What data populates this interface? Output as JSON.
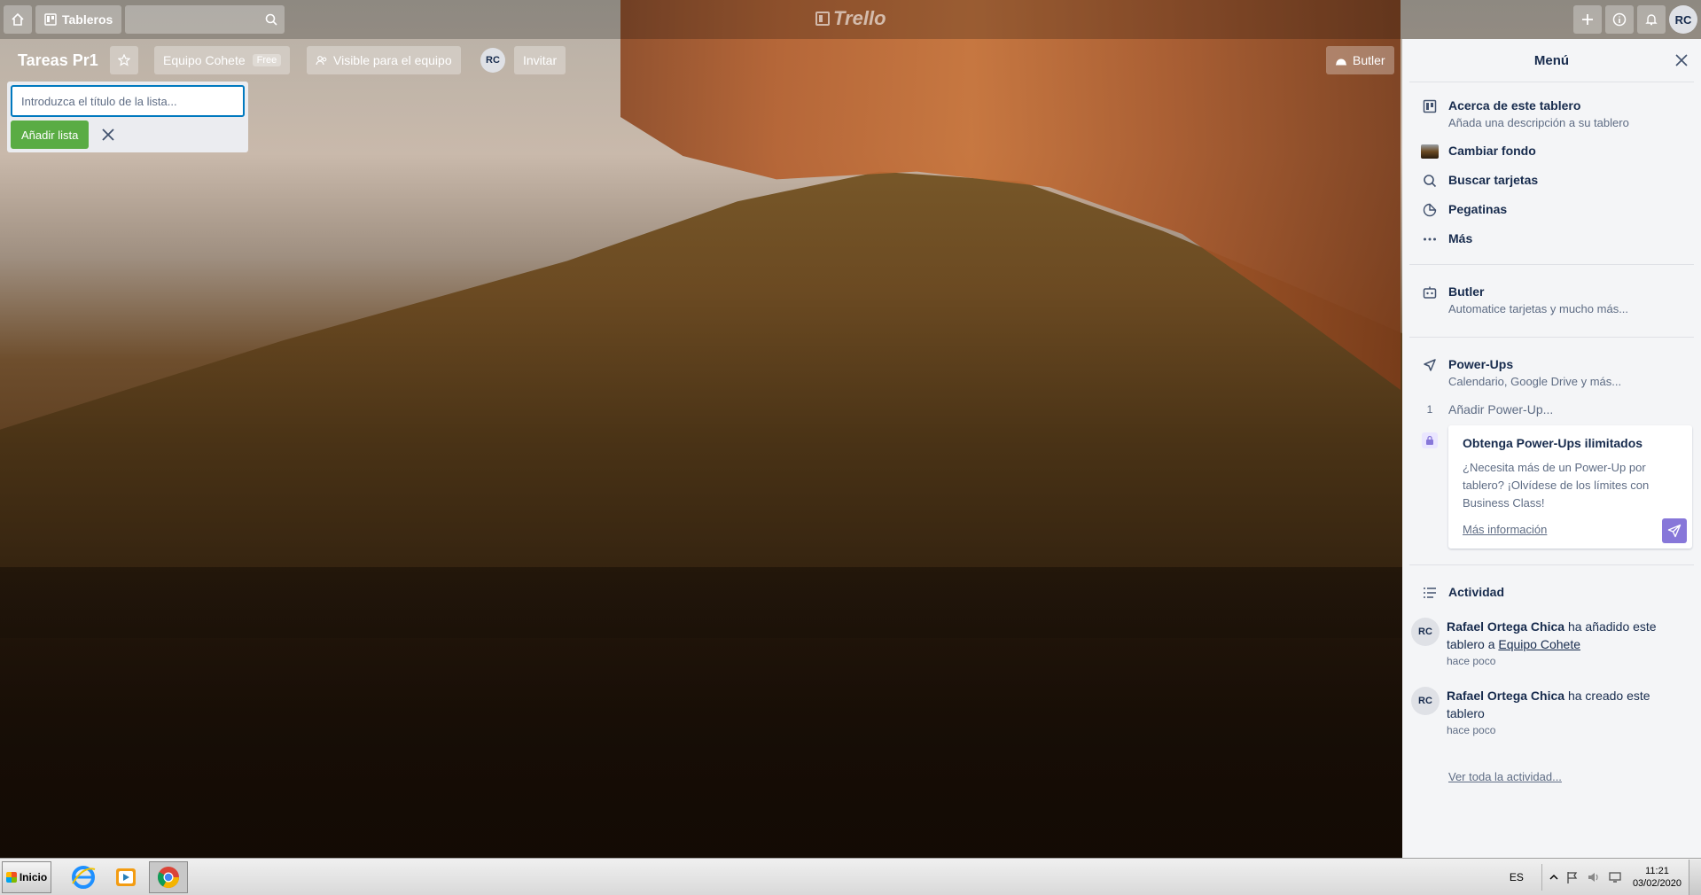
{
  "header": {
    "boards_label": "Tableros",
    "logo_text": "Trello",
    "user_initials": "RC"
  },
  "board": {
    "title": "Tareas Pr1",
    "team_label": "Equipo Cohete",
    "team_badge": "Free",
    "visibility_label": "Visible para el equipo",
    "member_initials": "RC",
    "invite_label": "Invitar",
    "butler_label": "Butler"
  },
  "composer": {
    "placeholder": "Introduzca el título de la lista...",
    "add_label": "Añadir lista"
  },
  "menu": {
    "title": "Menú",
    "items": [
      {
        "title": "Acerca de este tablero",
        "subtitle": "Añada una descripción a su tablero"
      },
      {
        "title": "Cambiar fondo"
      },
      {
        "title": "Buscar tarjetas"
      },
      {
        "title": "Pegatinas"
      },
      {
        "title": "Más"
      }
    ],
    "butler": {
      "title": "Butler",
      "subtitle": "Automatice tarjetas y mucho más..."
    },
    "powerups": {
      "title": "Power-Ups",
      "subtitle": "Calendario, Google Drive y más...",
      "count": "1",
      "add_label": "Añadir Power-Up..."
    },
    "promo": {
      "title": "Obtenga Power-Ups ilimitados",
      "text": "¿Necesita más de un Power-Up por tablero? ¡Olvídese de los límites con Business Class!",
      "link": "Más información"
    },
    "activity": {
      "title": "Actividad",
      "entries": [
        {
          "initials": "RC",
          "user": "Rafael Ortega Chica",
          "action": " ha añadido este tablero a ",
          "target": "Equipo Cohete",
          "time": "hace poco"
        },
        {
          "initials": "RC",
          "user": "Rafael Ortega Chica",
          "action": " ha creado este tablero",
          "target": "",
          "time": "hace poco"
        }
      ],
      "see_all": "Ver toda la actividad..."
    }
  },
  "taskbar": {
    "start_label": "Inicio",
    "lang": "ES",
    "time": "11:21",
    "date": "03/02/2020"
  }
}
